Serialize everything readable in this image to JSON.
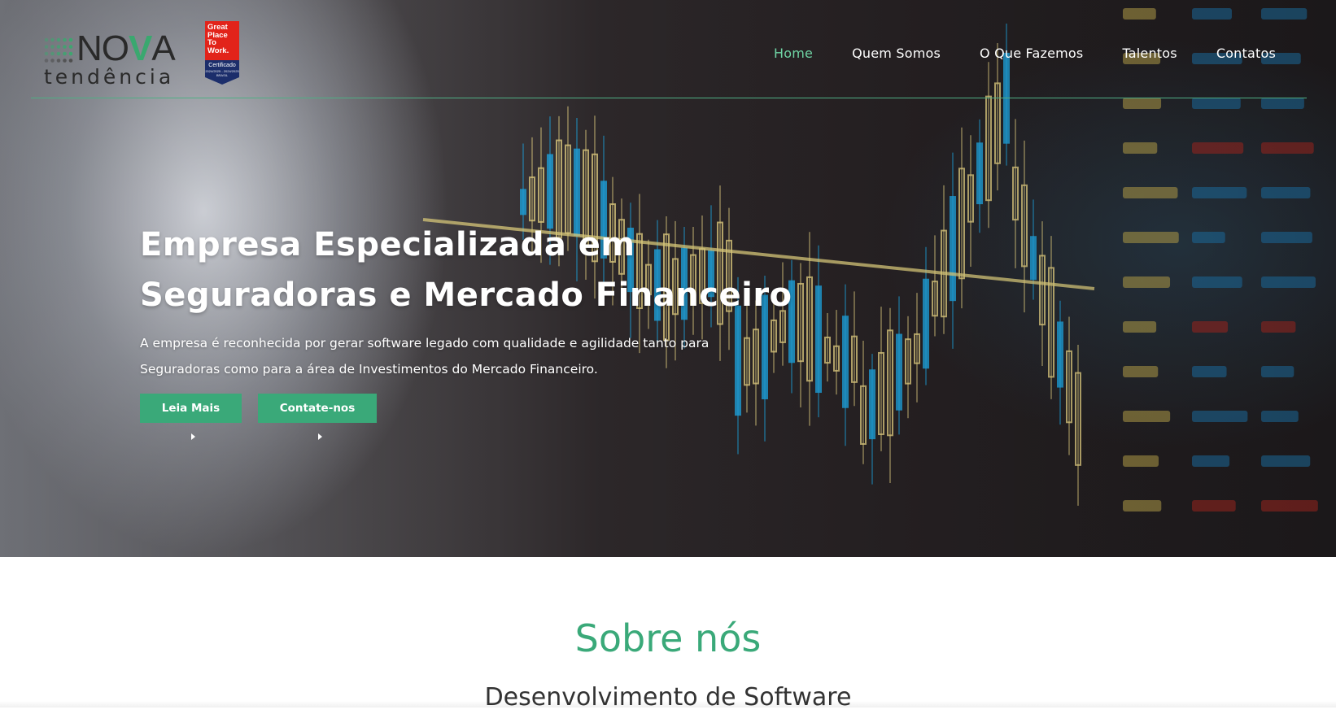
{
  "brand": {
    "logo_word_prefix": "NO",
    "logo_word_v": "V",
    "logo_word_suffix": "A",
    "logo_tagline": "tendência",
    "badge": {
      "lines": [
        "Great",
        "Place",
        "To",
        "Work."
      ],
      "certified": "Certificado",
      "period": "2024/2025 - 2024/2025",
      "country": "BRASIL"
    }
  },
  "nav": {
    "items": [
      {
        "label": "Home",
        "active": true
      },
      {
        "label": "Quem Somos",
        "active": false
      },
      {
        "label": "O Que Fazemos",
        "active": false
      },
      {
        "label": "Talentos",
        "active": false
      },
      {
        "label": "Contatos",
        "active": false
      }
    ]
  },
  "hero": {
    "title_line1": "Empresa Especializada em",
    "title_line2": "Seguradoras e Mercado Financeiro",
    "text_line1": "A empresa é reconhecida por gerar software legado com qualidade e agilidade tanto para",
    "text_line2": "Seguradoras como para a área de Investimentos do Mercado Financeiro.",
    "primary_button": "Leia Mais",
    "secondary_button": "Contate-nos"
  },
  "about": {
    "title": "Sobre nós",
    "subtitle": "Desenvolvimento de Software"
  },
  "colors": {
    "accent": "#3aa979",
    "nav_active": "#6fd4a4",
    "header_line": "#4fae84",
    "badge_red": "#e2231a",
    "badge_blue": "#1c2e6b"
  },
  "icons": {
    "button_caret": "caret-right-icon"
  }
}
